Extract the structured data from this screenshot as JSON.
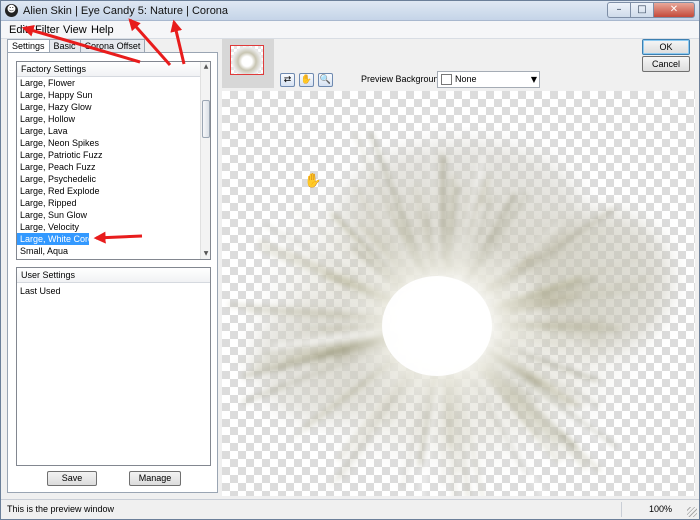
{
  "window": {
    "title": "Alien Skin | Eye Candy 5: Nature | Corona",
    "controls": {
      "minimize": "–",
      "maximize": "□",
      "close": "✕"
    }
  },
  "menu": [
    "Edit",
    "Filter",
    "View",
    "Help"
  ],
  "tabs": [
    "Settings",
    "Basic",
    "Corona Offset"
  ],
  "factory_settings": {
    "header": "Factory Settings",
    "items": [
      "Large, Flower",
      "Large, Happy Sun",
      "Large, Hazy Glow",
      "Large, Hollow",
      "Large, Lava",
      "Large, Neon Spikes",
      "Large, Patriotic Fuzz",
      "Large, Peach Fuzz",
      "Large, Psychedelic",
      "Large, Red Explode",
      "Large, Ripped",
      "Large, Sun Glow",
      "Large, Velocity",
      "Large, White Corona",
      "Small, Aqua"
    ],
    "selected": "Large, White Corona"
  },
  "user_settings": {
    "header": "User Settings",
    "items": [
      "Last Used"
    ]
  },
  "buttons": {
    "save": "Save",
    "manage": "Manage",
    "ok": "OK",
    "cancel": "Cancel"
  },
  "toolbar": {
    "icons": [
      "before-after-icon",
      "hand-icon",
      "zoom-icon"
    ],
    "preview_background_label": "Preview Background:",
    "preview_background_value": "None"
  },
  "status": {
    "message": "This is the preview window",
    "zoom": "100%"
  },
  "colors": {
    "annotation_arrow": "#e81c1c",
    "selection": "#3399ff",
    "thumbnail_border": "#e03a3a"
  }
}
